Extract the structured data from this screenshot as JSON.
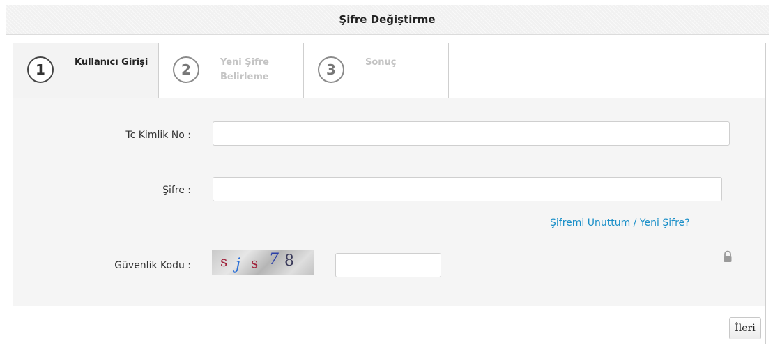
{
  "header": {
    "title": "Şifre Değiştirme"
  },
  "steps": [
    {
      "number": "1",
      "label": "Kullanıcı Girişi",
      "active": true
    },
    {
      "number": "2",
      "label": "Yeni Şifre Belirleme",
      "active": false
    },
    {
      "number": "3",
      "label": "Sonuç",
      "active": false
    }
  ],
  "form": {
    "tc_label": "Tc Kimlik No :",
    "tc_value": "",
    "password_label": "Şifre :",
    "password_value": "",
    "forgot_link": "Şifremi Unuttum / Yeni Şifre?",
    "security_label": "Güvenlik Kodu :",
    "captcha_text": "sjs78",
    "security_value": ""
  },
  "icons": {
    "lock": "lock-icon"
  },
  "footer": {
    "next_label": "İleri"
  }
}
